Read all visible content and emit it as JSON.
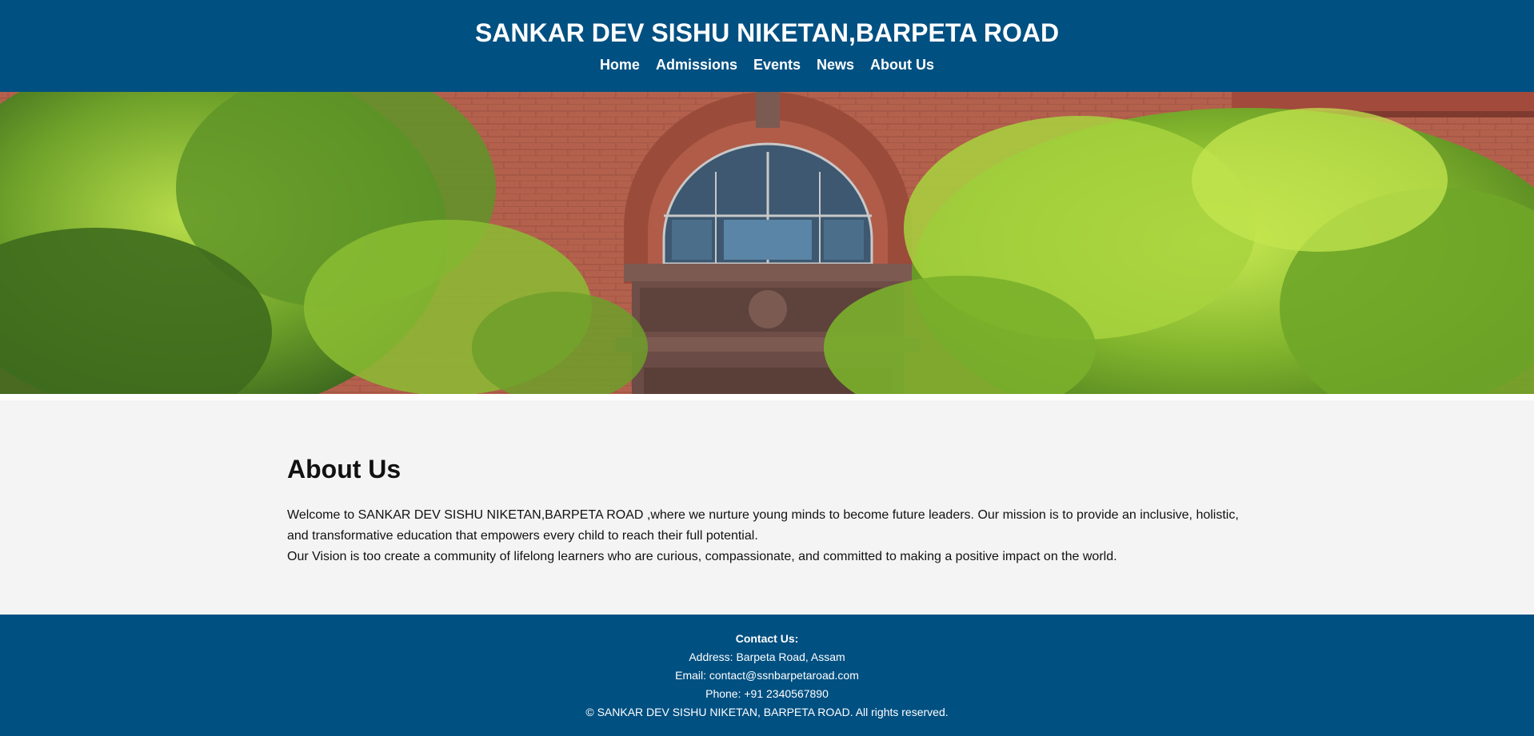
{
  "header": {
    "title": "SANKAR DEV SISHU NIKETAN,BARPETA ROAD",
    "nav": [
      "Home",
      "Admissions",
      "Events",
      "News",
      "About Us"
    ]
  },
  "hero": {
    "image": "school building with arched window and trees"
  },
  "about": {
    "heading": "About Us",
    "line1": "Welcome to SANKAR DEV SISHU NIKETAN,BARPETA ROAD ,where we nurture young minds to become future leaders. Our mission is to provide an inclusive, holistic, and transformative education that empowers every child to reach their full potential.",
    "line2": "Our Vision is too create a community of lifelong learners who are curious, compassionate, and committed to making a positive impact on the world."
  },
  "footer": {
    "contact_title": "Contact Us:",
    "address": "Address: Barpeta Road, Assam",
    "email": "Email: contact@ssnbarpetaroad.com",
    "phone": "Phone: +91 2340567890",
    "copyright": "© SANKAR DEV SISHU NIKETAN, BARPETA ROAD. All rights reserved."
  },
  "colors": {
    "header_bg": "#005082",
    "content_bg": "#f4f4f4"
  }
}
